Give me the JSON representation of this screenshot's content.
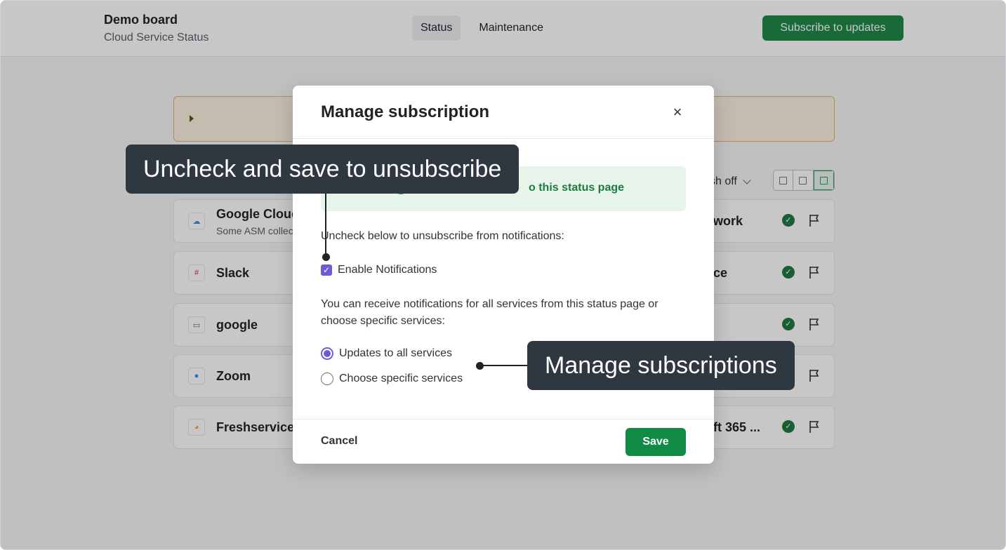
{
  "header": {
    "board_name": "Demo board",
    "board_subtitle": "Cloud Service Status",
    "nav": [
      {
        "label": "Status",
        "active": true
      },
      {
        "label": "Maintenance",
        "active": false
      }
    ],
    "subscribe_label": "Subscribe to updates"
  },
  "toolbar": {
    "refresh_label": "sh off"
  },
  "services": [
    {
      "name": "Google Clouc",
      "description": "Some ASM collec",
      "right_name": "work",
      "logo": "google-cloud-logo"
    },
    {
      "name": "Slack",
      "description": "",
      "right_name": "ce",
      "logo": "slack-logo"
    },
    {
      "name": "google",
      "description": "",
      "right_name": "",
      "logo": "monitor-logo"
    },
    {
      "name": "Zoom",
      "description": "",
      "right_name": "",
      "logo": "zoom-logo"
    },
    {
      "name": "Freshservice",
      "description": "",
      "right_name": "ft 365 ...",
      "logo": "freshservice-logo"
    }
  ],
  "modal": {
    "title": "Manage subscription",
    "close_glyph": "×",
    "success_text": "o this status page",
    "uncheck_instruction": "Uncheck below to unsubscribe from notifications:",
    "checkbox_label": "Enable Notifications",
    "checkbox_checked": true,
    "info_text": "You can receive notifications for all services from this status page or choose specific services:",
    "radio_options": [
      {
        "label": "Updates to all services",
        "selected": true
      },
      {
        "label": "Choose specific services",
        "selected": false
      }
    ],
    "cancel_label": "Cancel",
    "save_label": "Save"
  },
  "callouts": {
    "unsubscribe": "Uncheck and save to unsubscribe",
    "manage": "Manage subscriptions"
  },
  "colors": {
    "brand_green": "#1f8a4a",
    "accent_purple": "#6b5bd6",
    "callout_bg": "#2f3740"
  }
}
